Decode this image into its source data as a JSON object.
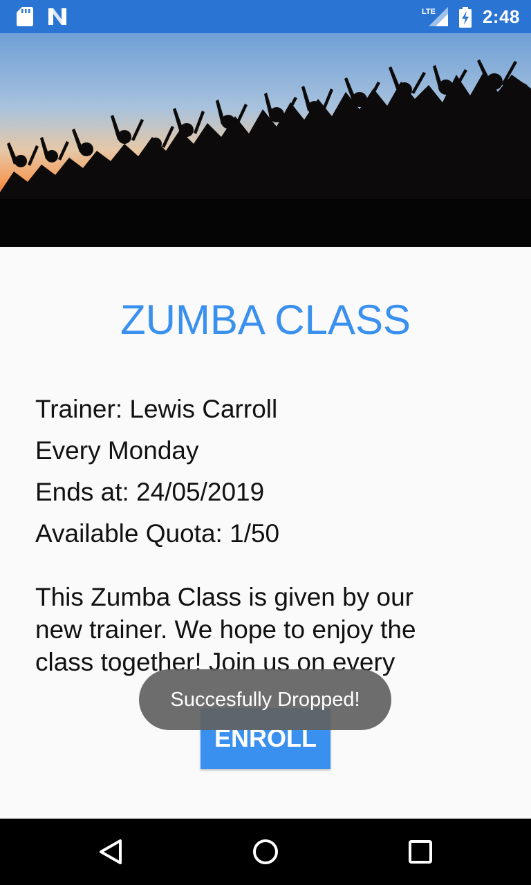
{
  "status_bar": {
    "time": "2:48",
    "network": "LTE",
    "icons": [
      "sd-card-icon",
      "n-notification-icon",
      "lte-signal-icon",
      "battery-charging-icon"
    ]
  },
  "hero": {
    "image": "sunset-jumping-crowd-silhouette"
  },
  "class": {
    "title": "ZUMBA CLASS",
    "trainer": "Trainer: Lewis Carroll",
    "schedule": "Every Monday",
    "ends_at": "Ends at: 24/05/2019",
    "quota": "Available Quota: 1/50",
    "description": "This Zumba Class is given by our new trainer. We hope to enjoy the class together! Join us on every"
  },
  "actions": {
    "enroll_label": "ENROLL"
  },
  "toast": {
    "message": "Succesfully Dropped!"
  },
  "nav_bar": {
    "icons": [
      "back-icon",
      "home-icon",
      "recents-icon"
    ]
  },
  "colors": {
    "status_bar": "#2a75d3",
    "accent": "#3a90ee",
    "background": "#fafafa",
    "toast": "#626262",
    "nav_bar": "#000000"
  }
}
